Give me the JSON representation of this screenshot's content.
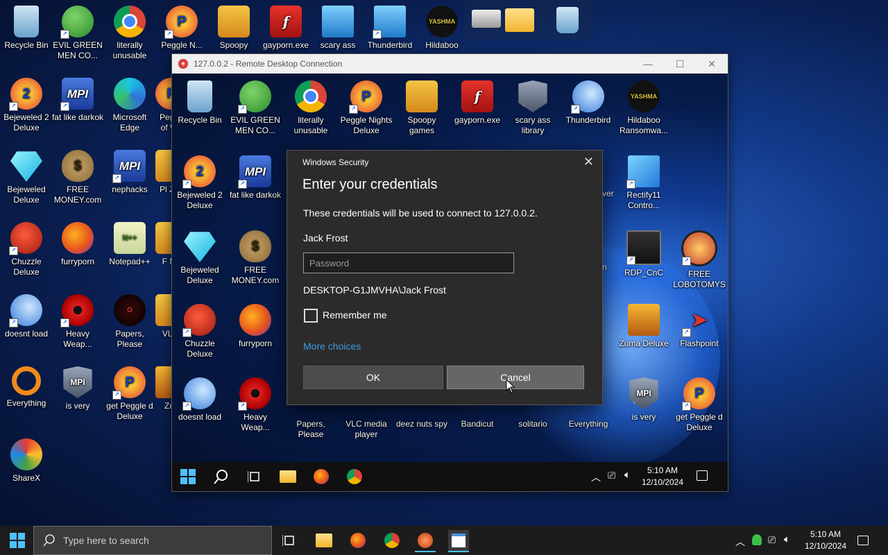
{
  "desktop_icons": [
    {
      "label": "Recycle Bin",
      "kind": "bin"
    },
    {
      "label": "EVIL GREEN MEN CO...",
      "kind": "green"
    },
    {
      "label": "literally unusable",
      "kind": "chrome"
    },
    {
      "label": "Peggle N...",
      "kind": "peggle"
    },
    {
      "label": "Spoopy",
      "kind": "box"
    },
    {
      "label": "gayporn.exe",
      "kind": "flash"
    },
    {
      "label": "scary ass",
      "kind": "monitor"
    },
    {
      "label": "Thunderbird",
      "kind": "monitor"
    },
    {
      "label": "Hildaboo",
      "kind": "yashma"
    },
    {
      "label": "Bejeweled 2 Deluxe",
      "kind": "gem"
    },
    {
      "label": "fat like darkok",
      "kind": "mpi"
    },
    {
      "label": "Microsoft Edge",
      "kind": "edge"
    },
    {
      "label": "Pegg of W",
      "kind": "peggle"
    },
    {
      "label": "Bejeweled Deluxe",
      "kind": "gem"
    },
    {
      "label": "FREE MONEY.com",
      "kind": "money"
    },
    {
      "label": "nephacks",
      "kind": "mpi"
    },
    {
      "label": "Pl Zo",
      "kind": "box"
    },
    {
      "label": "Chuzzle Deluxe",
      "kind": "chuzzle"
    },
    {
      "label": "furryporn",
      "kind": "firefox"
    },
    {
      "label": "Notepad++",
      "kind": "np"
    },
    {
      "label": "F M",
      "kind": "box"
    },
    {
      "label": "doesnt load",
      "kind": "tbird"
    },
    {
      "label": "Heavy Weap...",
      "kind": "rad"
    },
    {
      "label": "Papers, Please",
      "kind": "papers"
    },
    {
      "label": "VL l",
      "kind": "box"
    },
    {
      "label": "Everything",
      "kind": "everything"
    },
    {
      "label": "is very",
      "kind": "shield"
    },
    {
      "label": "get Peggle d Deluxe",
      "kind": "peggle"
    },
    {
      "label": "Zu",
      "kind": "zuma"
    },
    {
      "label": "ShareX",
      "kind": "sharex"
    }
  ],
  "rdp": {
    "title": "127.0.0.2 - Remote Desktop Connection",
    "minimize": "—",
    "maximize": "☐",
    "close": "✕",
    "icons": [
      {
        "label": "Recycle Bin",
        "kind": "bin"
      },
      {
        "label": "EVIL GREEN MEN CO...",
        "kind": "green"
      },
      {
        "label": "literally unusable",
        "kind": "chrome"
      },
      {
        "label": "Peggle Nights Deluxe",
        "kind": "peggle"
      },
      {
        "label": "Spoopy games",
        "kind": "box"
      },
      {
        "label": "gayporn.exe",
        "kind": "flash"
      },
      {
        "label": "scary ass library",
        "kind": "shield"
      },
      {
        "label": "Thunderbird",
        "kind": "tbird"
      },
      {
        "label": "Hildaboo Ransomwa...",
        "kind": "yashma"
      },
      {
        "label": "Bejeweled 2 Deluxe",
        "kind": "peggle"
      },
      {
        "label": "fat like darkok",
        "kind": "mpi"
      },
      {
        "label": "Rectify11 Contro...",
        "kind": "win11"
      },
      {
        "label": "Bejeweled Deluxe",
        "kind": "gem"
      },
      {
        "label": "FREE MONEY.com",
        "kind": "money"
      },
      {
        "label": "RDP_CnC",
        "kind": "rdpc"
      },
      {
        "label": "FREE LOBOTOMYS",
        "kind": "lobo"
      },
      {
        "label": "Chuzzle Deluxe",
        "kind": "chuzzle"
      },
      {
        "label": "furryporn",
        "kind": "firefox"
      },
      {
        "label": "Zuma Deluxe",
        "kind": "zuma"
      },
      {
        "label": "Flashpoint",
        "kind": "flashpoint"
      },
      {
        "label": "doesnt load",
        "kind": "tbird"
      },
      {
        "label": "Heavy Weap...",
        "kind": "rad"
      },
      {
        "label": "Papers, Please",
        "kind": "papers"
      },
      {
        "label": "VLC media player",
        "kind": "box"
      },
      {
        "label": "deez nuts spy",
        "kind": "box"
      },
      {
        "label": "Bandicut",
        "kind": "box"
      },
      {
        "label": "solitario",
        "kind": "box"
      },
      {
        "label": "Everything",
        "kind": "everything"
      },
      {
        "label": "is very",
        "kind": "shield"
      },
      {
        "label": "get Peggle d Deluxe",
        "kind": "peggle"
      }
    ],
    "partial_labels": {
      "ver": "ver",
      "n": "n"
    },
    "taskbar": {
      "time": "5:10 AM",
      "date": "12/10/2024"
    }
  },
  "dialog": {
    "header": "Windows Security",
    "heading": "Enter your credentials",
    "description": "These credentials will be used to connect to 127.0.0.2.",
    "username": "Jack Frost",
    "password_placeholder": "Password",
    "domain_user": "DESKTOP-G1JMVHA\\Jack Frost",
    "remember_label": "Remember me",
    "more_choices": "More choices",
    "ok": "OK",
    "cancel": "Cancel",
    "close": "✕"
  },
  "taskbar": {
    "search_placeholder": "Type here to search",
    "time": "5:10 AM",
    "date": "12/10/2024"
  },
  "colors": {
    "accent": "#3e9be6",
    "taskbar": "#1c1c1c",
    "dialog": "#2b2b2b"
  }
}
